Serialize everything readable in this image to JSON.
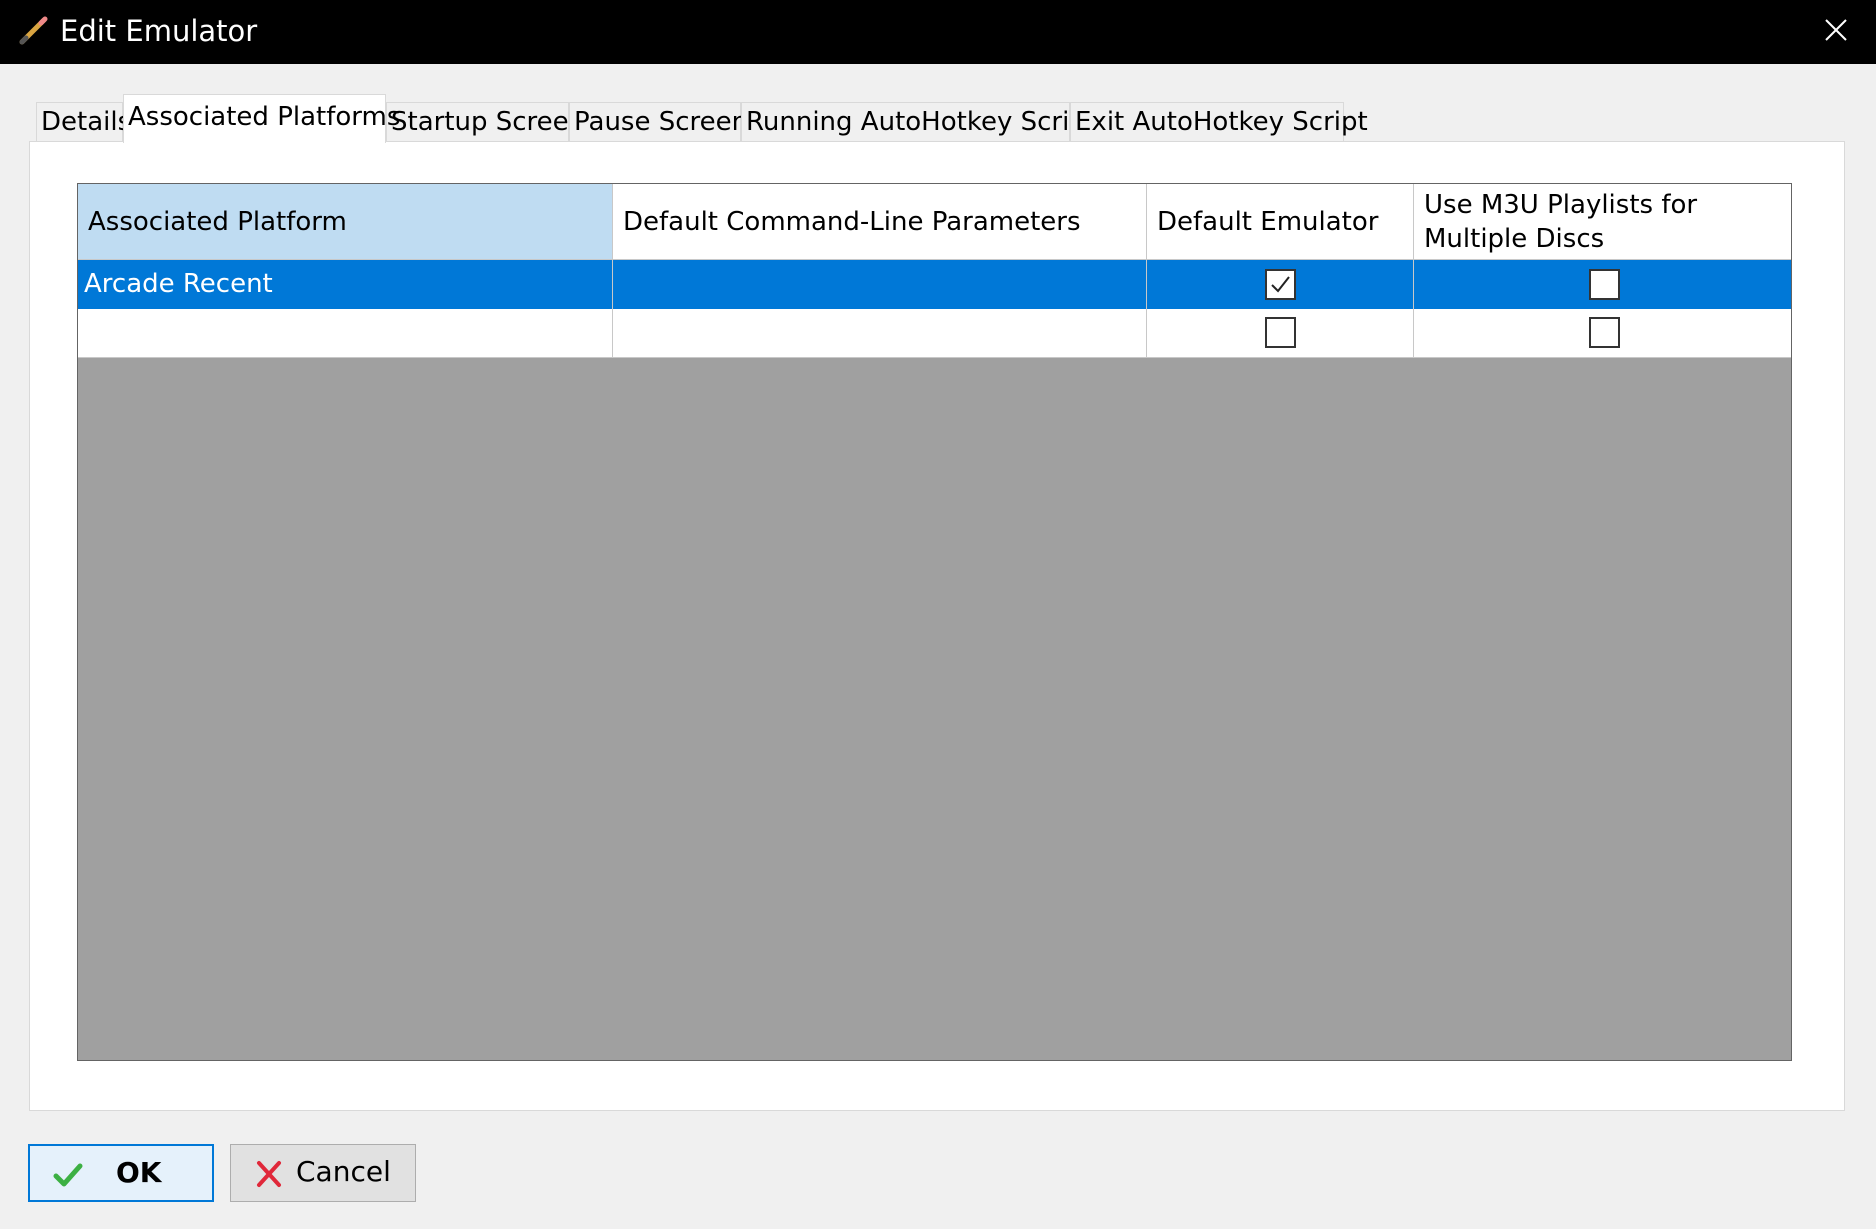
{
  "window": {
    "title": "Edit Emulator",
    "icon": "pencil-icon"
  },
  "tabs": [
    {
      "label": "Details",
      "active": false
    },
    {
      "label": "Associated Platforms",
      "active": true
    },
    {
      "label": "Startup Screen",
      "active": false
    },
    {
      "label": "Pause Screen",
      "active": false
    },
    {
      "label": "Running AutoHotkey Script",
      "active": false
    },
    {
      "label": "Exit AutoHotkey Script",
      "active": false
    }
  ],
  "grid": {
    "columns": [
      "Associated Platform",
      "Default Command-Line Parameters",
      "Default Emulator",
      "Use M3U Playlists for Multiple Discs"
    ],
    "rows": [
      {
        "platform": "Arcade Recent",
        "params": "",
        "default_emulator": true,
        "use_m3u": false,
        "selected": true
      },
      {
        "platform": "",
        "params": "",
        "default_emulator": false,
        "use_m3u": false,
        "selected": false
      }
    ]
  },
  "buttons": {
    "ok_label": "OK",
    "cancel_label": "Cancel"
  },
  "colors": {
    "title_bar": "#000000",
    "selection": "#0078d7",
    "selected_column_header": "#bfdcf2",
    "grid_empty_area": "#a0a0a0"
  }
}
